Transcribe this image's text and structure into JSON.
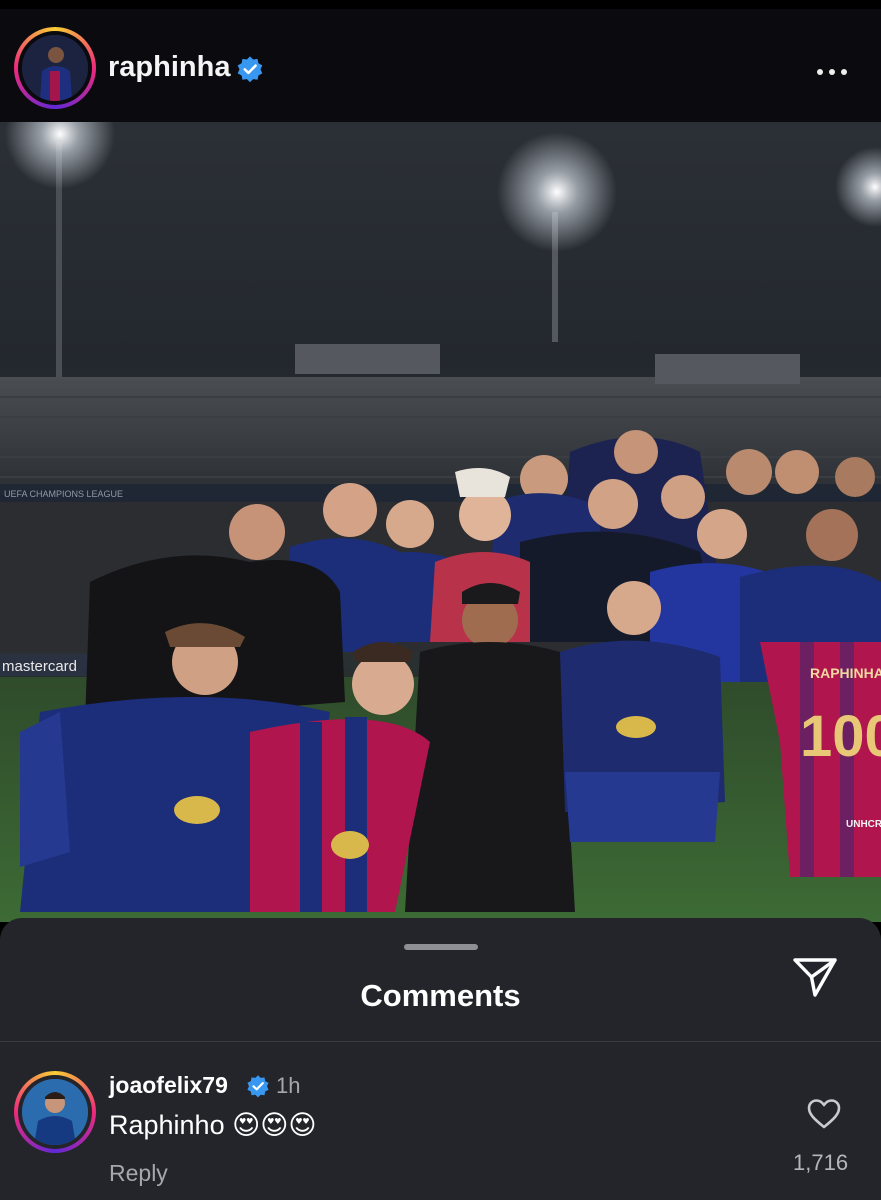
{
  "post": {
    "username": "raphinha",
    "verified": true,
    "more_icon": "more-horizontal-icon",
    "photo": {
      "stadium_board": "UEFA CHAMPIONS LEAGUE",
      "ad_board": "mastercard",
      "jersey_name": "RAPHINHA",
      "jersey_number": "100",
      "jersey_sponsor": "UNHCR ACNUR"
    }
  },
  "comments_sheet": {
    "title": "Comments",
    "share_icon": "send-icon",
    "comments": [
      {
        "username": "joaofelix79",
        "verified": true,
        "time": "1h",
        "text": "Raphinho 😍😍😍",
        "reply_label": "Reply",
        "likes": "1,716"
      }
    ]
  },
  "colors": {
    "background": "#000000",
    "header_bg": "#0b0b0f",
    "sheet_bg": "#24252a",
    "verified_blue": "#3897f0",
    "secondary_text": "#a6a7ac",
    "barca_blue": "#1c2e7a",
    "barca_red": "#b0154e"
  }
}
